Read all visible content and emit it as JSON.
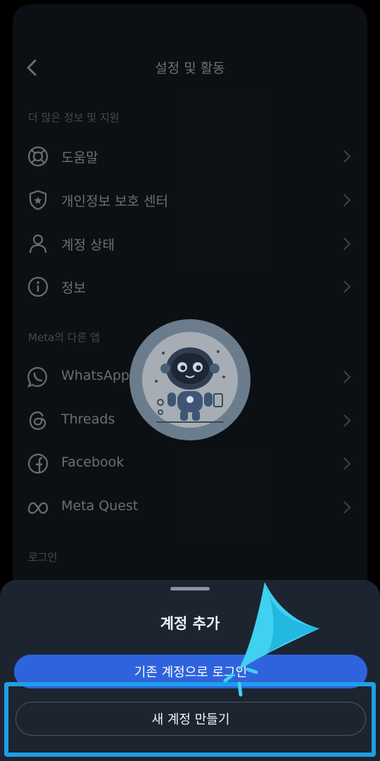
{
  "header": {
    "title": "설정 및 활동"
  },
  "sections": [
    {
      "label": "더 많은 정보 및 지원",
      "items": [
        {
          "label": "도움말",
          "icon": "lifebuoy-icon"
        },
        {
          "label": "개인정보 보호 센터",
          "icon": "shield-icon"
        },
        {
          "label": "계정 상태",
          "icon": "person-icon"
        },
        {
          "label": "정보",
          "icon": "info-icon"
        }
      ]
    },
    {
      "label": "Meta의 다른 앱",
      "items": [
        {
          "label": "WhatsApp",
          "icon": "whatsapp-icon"
        },
        {
          "label": "Threads",
          "icon": "threads-icon"
        },
        {
          "label": "Facebook",
          "icon": "facebook-icon"
        },
        {
          "label": "Meta Quest",
          "icon": "meta-icon"
        }
      ]
    },
    {
      "label": "로그인",
      "items": []
    }
  ],
  "sheet": {
    "title": "계정 추가",
    "login_existing_label": "기존 계정으로 로그인",
    "create_new_label": "새 계정 만들기"
  },
  "colors": {
    "primary_button": "#2f63dd",
    "highlight": "#1e9fe6",
    "cursor": "#3fd0f2"
  }
}
